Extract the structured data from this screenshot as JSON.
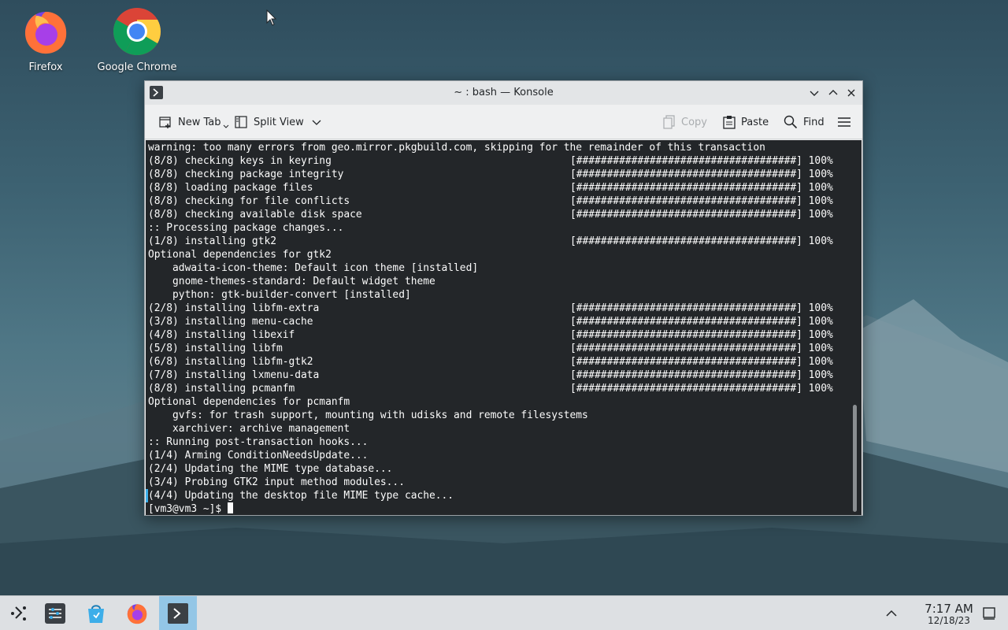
{
  "desktop": {
    "icons": [
      {
        "label": "Firefox"
      },
      {
        "label": "Google Chrome"
      }
    ]
  },
  "window": {
    "title": "~ : bash — Konsole",
    "toolbar": {
      "new_tab": "New Tab",
      "split_view": "Split View",
      "copy": "Copy",
      "paste": "Paste",
      "find": "Find"
    }
  },
  "terminal": {
    "lines": [
      {
        "text": "warning: too many errors from geo.mirror.pkgbuild.com, skipping for the remainder of this transaction",
        "progress": ""
      },
      {
        "text": "(8/8) checking keys in keyring",
        "progress": "[####################################] 100%"
      },
      {
        "text": "(8/8) checking package integrity",
        "progress": "[####################################] 100%"
      },
      {
        "text": "(8/8) loading package files",
        "progress": "[####################################] 100%"
      },
      {
        "text": "(8/8) checking for file conflicts",
        "progress": "[####################################] 100%"
      },
      {
        "text": "(8/8) checking available disk space",
        "progress": "[####################################] 100%"
      },
      {
        "text": ":: Processing package changes...",
        "progress": ""
      },
      {
        "text": "(1/8) installing gtk2",
        "progress": "[####################################] 100%"
      },
      {
        "text": "Optional dependencies for gtk2",
        "progress": ""
      },
      {
        "text": "    adwaita-icon-theme: Default icon theme [installed]",
        "progress": ""
      },
      {
        "text": "    gnome-themes-standard: Default widget theme",
        "progress": ""
      },
      {
        "text": "    python: gtk-builder-convert [installed]",
        "progress": ""
      },
      {
        "text": "(2/8) installing libfm-extra",
        "progress": "[####################################] 100%"
      },
      {
        "text": "(3/8) installing menu-cache",
        "progress": "[####################################] 100%"
      },
      {
        "text": "(4/8) installing libexif",
        "progress": "[####################################] 100%"
      },
      {
        "text": "(5/8) installing libfm",
        "progress": "[####################################] 100%"
      },
      {
        "text": "(6/8) installing libfm-gtk2",
        "progress": "[####################################] 100%"
      },
      {
        "text": "(7/8) installing lxmenu-data",
        "progress": "[####################################] 100%"
      },
      {
        "text": "(8/8) installing pcmanfm",
        "progress": "[####################################] 100%"
      },
      {
        "text": "Optional dependencies for pcmanfm",
        "progress": ""
      },
      {
        "text": "    gvfs: for trash support, mounting with udisks and remote filesystems",
        "progress": ""
      },
      {
        "text": "    xarchiver: archive management",
        "progress": ""
      },
      {
        "text": ":: Running post-transaction hooks...",
        "progress": ""
      },
      {
        "text": "(1/4) Arming ConditionNeedsUpdate...",
        "progress": ""
      },
      {
        "text": "(2/4) Updating the MIME type database...",
        "progress": ""
      },
      {
        "text": "(3/4) Probing GTK2 input method modules...",
        "progress": ""
      },
      {
        "text": "(4/4) Updating the desktop file MIME type cache...",
        "progress": ""
      }
    ],
    "prompt": "[vm3@vm3 ~]$ "
  },
  "taskbar": {
    "time": "7:17 AM",
    "date": "12/18/23"
  },
  "colors": {
    "terminal_bg": "#232629",
    "terminal_fg": "#fcfcfc",
    "accent": "#3daee9",
    "active_task": "#93c6e6"
  }
}
